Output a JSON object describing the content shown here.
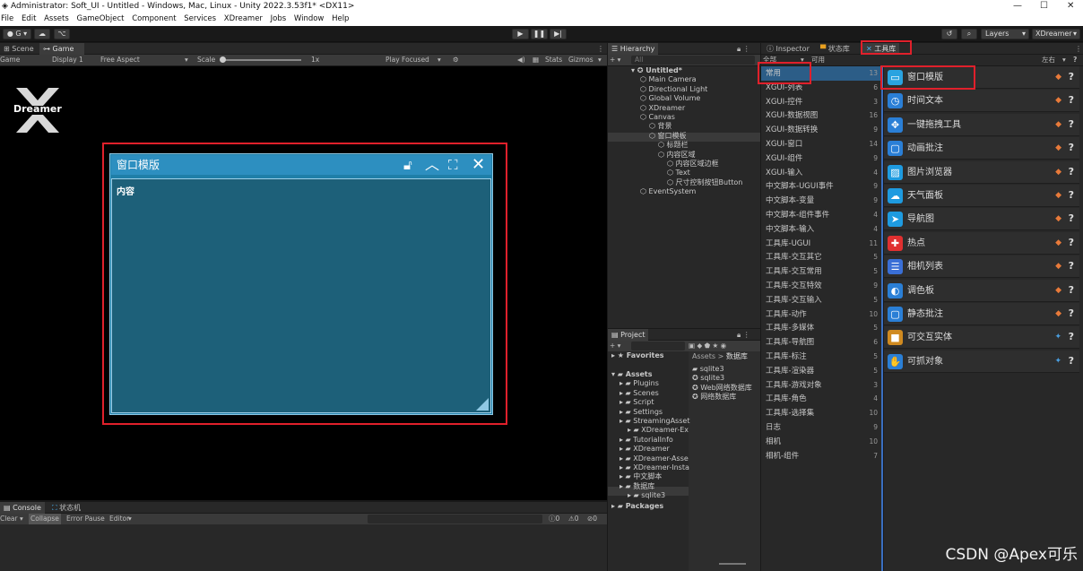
{
  "window": {
    "title": "Administrator: Soft_UI - Untitled - Windows, Mac, Linux - Unity 2022.3.53f1* <DX11>",
    "minimize": "—",
    "maximize": "☐",
    "close": "✕"
  },
  "menu": [
    "File",
    "Edit",
    "Assets",
    "GameObject",
    "Component",
    "Services",
    "XDreamer",
    "Jobs",
    "Window",
    "Help"
  ],
  "toolbar": {
    "account": "G",
    "layers": "Layers",
    "layout": "XDreamer"
  },
  "scene_tabs": {
    "scene": "Scene",
    "game": "Game"
  },
  "game_bar": {
    "game": "Game",
    "display": "Display 1",
    "aspect": "Free Aspect",
    "scale": "Scale",
    "scale_value": "1x",
    "play_focused": "Play Focused",
    "stats": "Stats",
    "gizmos": "Gizmos"
  },
  "logo": {
    "text": "Dreamer"
  },
  "ui_window": {
    "title": "窗口模版",
    "content": "内容"
  },
  "hierarchy": {
    "tab": "Hierarchy",
    "search": "All",
    "items": [
      {
        "label": "Untitled*",
        "depth": 0
      },
      {
        "label": "Main Camera",
        "depth": 1
      },
      {
        "label": "Directional Light",
        "depth": 1
      },
      {
        "label": "Global Volume",
        "depth": 1
      },
      {
        "label": "XDreamer",
        "depth": 1
      },
      {
        "label": "Canvas",
        "depth": 1
      },
      {
        "label": "背景",
        "depth": 2
      },
      {
        "label": "窗口模板",
        "depth": 2
      },
      {
        "label": "标题栏",
        "depth": 3
      },
      {
        "label": "内容区域",
        "depth": 3
      },
      {
        "label": "内容区域边框",
        "depth": 4
      },
      {
        "label": "Text",
        "depth": 4
      },
      {
        "label": "尺寸控制按钮Button",
        "depth": 4
      },
      {
        "label": "EventSystem",
        "depth": 1
      }
    ]
  },
  "project": {
    "tab": "Project",
    "favorites": "Favorites",
    "assets": "Assets",
    "breadcrumb_root": "Assets",
    "breadcrumb_leaf": "数据库",
    "tree": [
      {
        "label": "Assets",
        "depth": 0
      },
      {
        "label": "Plugins",
        "depth": 1
      },
      {
        "label": "Scenes",
        "depth": 1
      },
      {
        "label": "Script",
        "depth": 1
      },
      {
        "label": "Settings",
        "depth": 1
      },
      {
        "label": "StreamingAsset",
        "depth": 1
      },
      {
        "label": "XDreamer-Ex",
        "depth": 2
      },
      {
        "label": "TutorialInfo",
        "depth": 1
      },
      {
        "label": "XDreamer",
        "depth": 1
      },
      {
        "label": "XDreamer-Asse",
        "depth": 1
      },
      {
        "label": "XDreamer-Insta",
        "depth": 1
      },
      {
        "label": "中文脚本",
        "depth": 1
      },
      {
        "label": "数据库",
        "depth": 1
      },
      {
        "label": "sqlite3",
        "depth": 2
      }
    ],
    "packages": "Packages",
    "files": [
      "sqlite3",
      "sqlite3",
      "Web网络数据库",
      "网络数据库"
    ]
  },
  "inspector_tabs": {
    "inspector": "Inspector",
    "state": "状态库",
    "tools": "工具库"
  },
  "tool_bar": {
    "all": "全部",
    "available": "可用",
    "layout": "左右"
  },
  "categories": [
    {
      "label": "常用",
      "count": "13"
    },
    {
      "label": "XGUI-列表",
      "count": "6"
    },
    {
      "label": "XGUI-控件",
      "count": "3"
    },
    {
      "label": "XGUI-数据视图",
      "count": "16"
    },
    {
      "label": "XGUI-数据转换",
      "count": "9"
    },
    {
      "label": "XGUI-窗口",
      "count": "14"
    },
    {
      "label": "XGUI-组件",
      "count": "9"
    },
    {
      "label": "XGUI-输入",
      "count": "4"
    },
    {
      "label": "中文脚本-UGUI事件",
      "count": "9"
    },
    {
      "label": "中文脚本-变量",
      "count": "9"
    },
    {
      "label": "中文脚本-组件事件",
      "count": "4"
    },
    {
      "label": "中文脚本-输入",
      "count": "4"
    },
    {
      "label": "工具库-UGUI",
      "count": "11"
    },
    {
      "label": "工具库-交互其它",
      "count": "5"
    },
    {
      "label": "工具库-交互常用",
      "count": "5"
    },
    {
      "label": "工具库-交互特效",
      "count": "9"
    },
    {
      "label": "工具库-交互输入",
      "count": "5"
    },
    {
      "label": "工具库-动作",
      "count": "10"
    },
    {
      "label": "工具库-多媒体",
      "count": "5"
    },
    {
      "label": "工具库-导航图",
      "count": "6"
    },
    {
      "label": "工具库-标注",
      "count": "5"
    },
    {
      "label": "工具库-渲染器",
      "count": "5"
    },
    {
      "label": "工具库-游戏对象",
      "count": "3"
    },
    {
      "label": "工具库-角色",
      "count": "4"
    },
    {
      "label": "工具库-选择集",
      "count": "10"
    },
    {
      "label": "日志",
      "count": "9"
    },
    {
      "label": "相机",
      "count": "10"
    },
    {
      "label": "相机-组件",
      "count": "7"
    }
  ],
  "tools": [
    {
      "label": "窗口模版",
      "icon": "window-icon",
      "color": "#2aa3e0"
    },
    {
      "label": "时间文本",
      "icon": "clock-icon",
      "color": "#2a7fd6"
    },
    {
      "label": "一键拖拽工具",
      "icon": "drag-icon",
      "color": "#2a7fd6"
    },
    {
      "label": "动画批注",
      "icon": "comment-icon",
      "color": "#2a7fd6"
    },
    {
      "label": "图片浏览器",
      "icon": "image-icon",
      "color": "#1e9be0"
    },
    {
      "label": "天气面板",
      "icon": "cloud-icon",
      "color": "#1e9be0"
    },
    {
      "label": "导航图",
      "icon": "navigation-icon",
      "color": "#1e9be0"
    },
    {
      "label": "热点",
      "icon": "hotspot-icon",
      "color": "#e03030"
    },
    {
      "label": "相机列表",
      "icon": "list-icon",
      "color": "#3a6fd6"
    },
    {
      "label": "调色板",
      "icon": "palette-icon",
      "color": "#2a7fd6"
    },
    {
      "label": "静态批注",
      "icon": "comment-icon",
      "color": "#2a7fd6"
    },
    {
      "label": "可交互实体",
      "icon": "cube-icon",
      "color": "#d08a20"
    },
    {
      "label": "可抓对象",
      "icon": "grab-icon",
      "color": "#2a7fd6"
    }
  ],
  "console": {
    "tab": "Console",
    "state_tab": "状态机",
    "clear": "Clear",
    "collapse": "Collapse",
    "error_pause": "Error Pause",
    "editor": "Editor",
    "c0": "0",
    "c1": "0",
    "c2": "0"
  },
  "watermark": "CSDN @Apex可乐",
  "colors": {
    "highlight": "#2c5d87",
    "red": "#e0202b"
  }
}
